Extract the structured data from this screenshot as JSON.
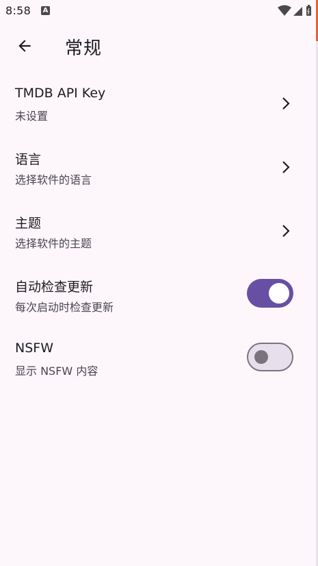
{
  "status_bar": {
    "time": "8:58",
    "notification_icon_letter": "A"
  },
  "app_bar": {
    "title": "常规"
  },
  "settings": [
    {
      "title": "TMDB API Key",
      "subtitle": "未设置",
      "control": "chevron"
    },
    {
      "title": "语言",
      "subtitle": "选择软件的语言",
      "control": "chevron"
    },
    {
      "title": "主题",
      "subtitle": "选择软件的主题",
      "control": "chevron"
    },
    {
      "title": "自动检查更新",
      "subtitle": "每次启动时检查更新",
      "control": "switch",
      "checked": true
    },
    {
      "title": "NSFW",
      "subtitle": "显示 NSFW 内容",
      "control": "switch",
      "checked": false
    }
  ],
  "colors": {
    "background": "#fdf7fc",
    "switch_on_track": "#6750a4",
    "switch_off_track": "#e7e0ec",
    "switch_off_border": "#79747e"
  },
  "icons": {
    "back": "arrow-back-icon",
    "chevron": "chevron-right-icon",
    "wifi": "wifi-icon",
    "signal": "signal-icon",
    "battery": "battery-icon"
  }
}
